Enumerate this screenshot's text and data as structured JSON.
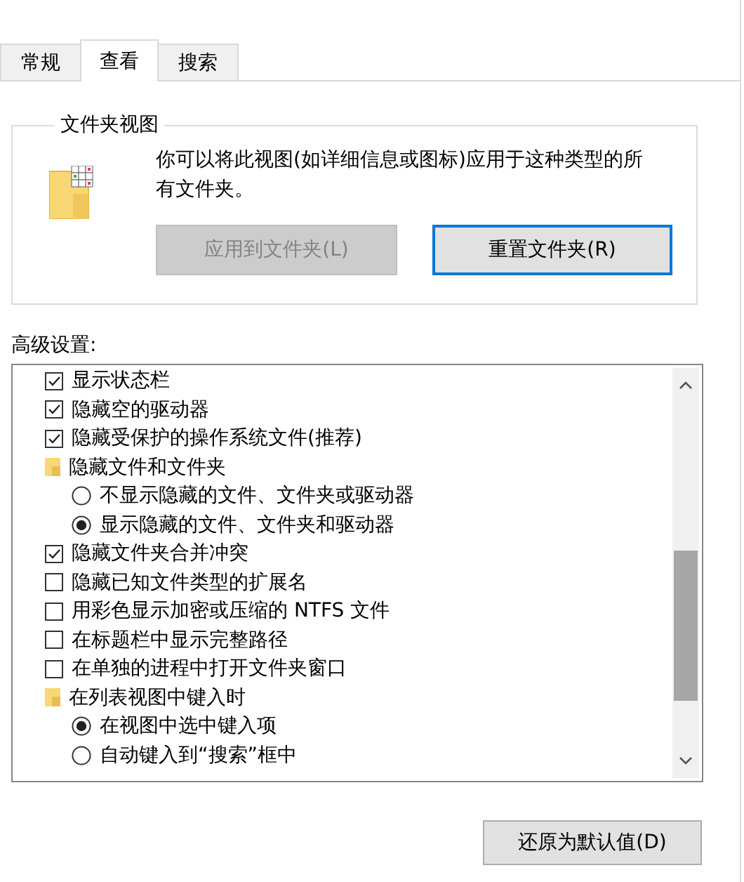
{
  "tabs": [
    {
      "label": "常规",
      "selected": false
    },
    {
      "label": "查看",
      "selected": true
    },
    {
      "label": "搜索",
      "selected": false
    }
  ],
  "folder_views": {
    "title": "文件夹视图",
    "description": "你可以将此视图(如详细信息或图标)应用于这种类型的所有文件夹。",
    "buttons": [
      {
        "label": "应用到文件夹(L)",
        "disabled": true,
        "default": false
      },
      {
        "label": "重置文件夹(R)",
        "disabled": false,
        "default": true
      }
    ]
  },
  "advanced": {
    "label": "高级设置:",
    "items": [
      {
        "kind": "checkbox",
        "label": "显示状态栏",
        "checked": true
      },
      {
        "kind": "checkbox",
        "label": "隐藏空的驱动器",
        "checked": true
      },
      {
        "kind": "checkbox",
        "label": "隐藏受保护的操作系统文件(推荐)",
        "checked": true
      },
      {
        "kind": "folder",
        "label": "隐藏文件和文件夹",
        "children": [
          {
            "kind": "radio",
            "label": "不显示隐藏的文件、文件夹或驱动器",
            "selected": false
          },
          {
            "kind": "radio",
            "label": "显示隐藏的文件、文件夹和驱动器",
            "selected": true
          }
        ]
      },
      {
        "kind": "checkbox",
        "label": "隐藏文件夹合并冲突",
        "checked": true
      },
      {
        "kind": "checkbox",
        "label": "隐藏已知文件类型的扩展名",
        "checked": false
      },
      {
        "kind": "checkbox",
        "label": "用彩色显示加密或压缩的 NTFS 文件",
        "checked": false
      },
      {
        "kind": "checkbox",
        "label": "在标题栏中显示完整路径",
        "checked": false
      },
      {
        "kind": "checkbox",
        "label": "在单独的进程中打开文件夹窗口",
        "checked": false
      },
      {
        "kind": "folder",
        "label": "在列表视图中键入时",
        "children": [
          {
            "kind": "radio",
            "label": "在视图中选中键入项",
            "selected": true
          },
          {
            "kind": "radio",
            "label": "自动键入到“搜索”框中",
            "selected": false
          }
        ]
      }
    ]
  },
  "restore_button": "还原为默认值(D)"
}
